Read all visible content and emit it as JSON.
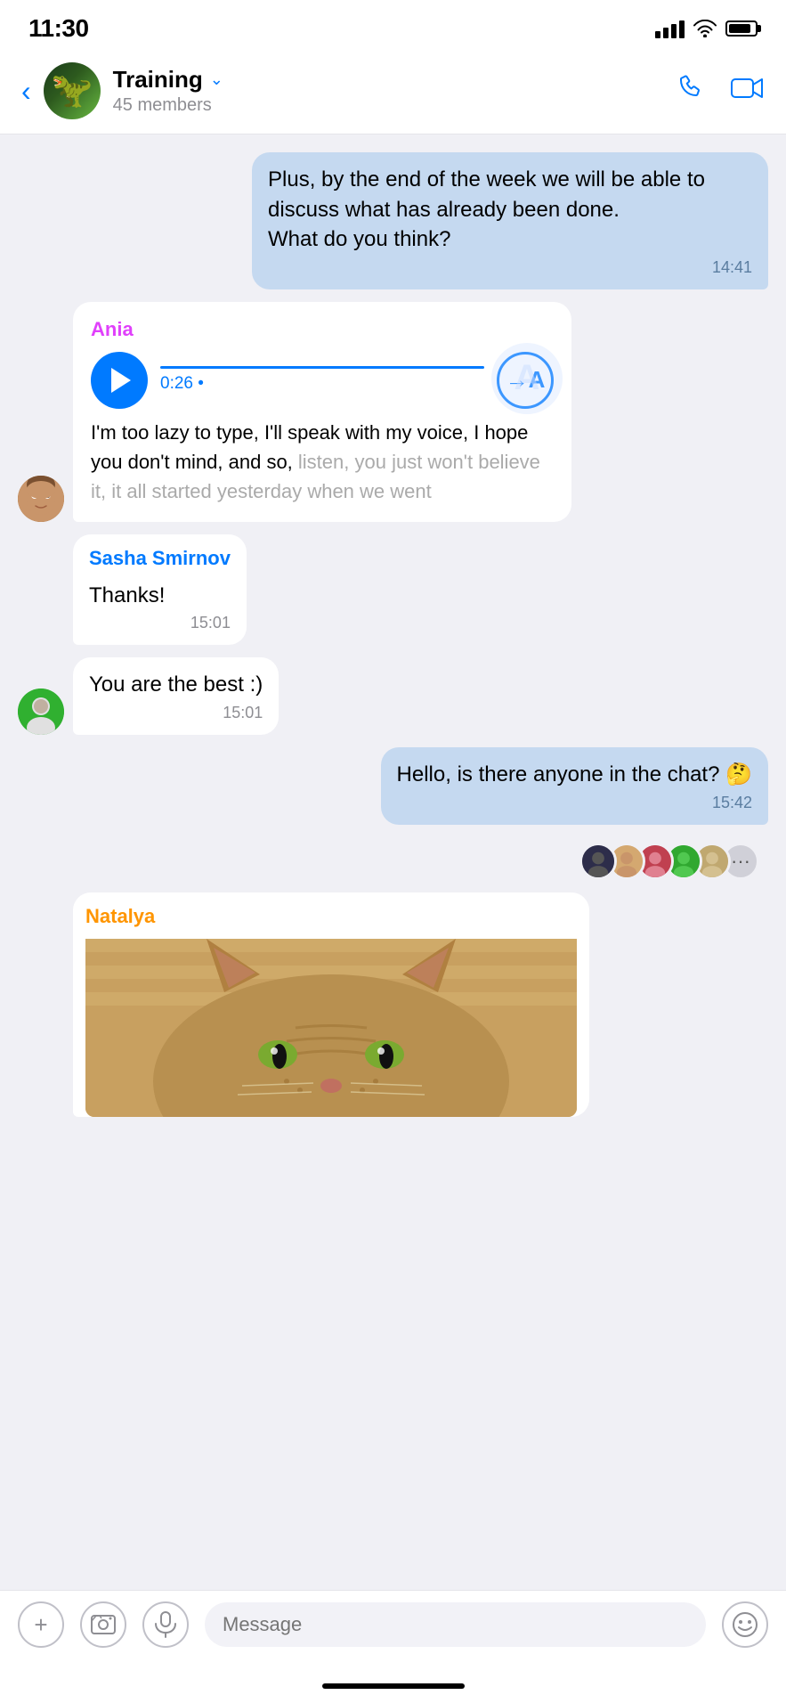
{
  "statusBar": {
    "time": "11:30",
    "signalBars": [
      8,
      12,
      16,
      20
    ],
    "batteryPercent": 85
  },
  "header": {
    "backLabel": "‹",
    "groupName": "Training",
    "dropdownArrow": "∨",
    "membersCount": "45 members",
    "callIcon": "📞",
    "videoIcon": "📹"
  },
  "messages": [
    {
      "id": "msg1",
      "type": "outgoing",
      "text": "Plus, by the end of the week we will be able to discuss what has already been done.\nWhat do you think?",
      "time": "14:41"
    },
    {
      "id": "msg2",
      "type": "voice-incoming",
      "sender": "Ania",
      "senderColor": "ania",
      "duration": "0:26",
      "transcript": "I'm too lazy to type, I'll speak with my voice, I hope you don't mind, and so, listen, you just won't believe it, it all started yesterday when we went"
    },
    {
      "id": "msg3",
      "type": "sasha-group",
      "sender": "Sasha Smirnov",
      "senderColor": "sasha",
      "messages": [
        {
          "text": "Thanks!",
          "time": "15:01"
        },
        {
          "text": "You are the best :)",
          "time": "15:01"
        }
      ]
    },
    {
      "id": "msg4",
      "type": "outgoing",
      "text": "Hello, is there anyone in the chat? 🤔",
      "time": "15:42",
      "reactions": [
        "👤",
        "👤",
        "👤",
        "👤",
        "👤",
        "..."
      ]
    },
    {
      "id": "msg5",
      "type": "image-incoming",
      "sender": "Natalya",
      "senderColor": "natalya",
      "imageDesc": "cat image"
    }
  ],
  "inputBar": {
    "addIcon": "+",
    "photoIcon": "🖼",
    "micIcon": "🎤",
    "placeholder": "Message",
    "emojiIcon": "🙂"
  },
  "reactions": {
    "avatarColors": [
      "#2d2d4a",
      "#d4a870",
      "#c04050",
      "#30a830",
      "#c0a870"
    ],
    "moreLabel": "···"
  }
}
